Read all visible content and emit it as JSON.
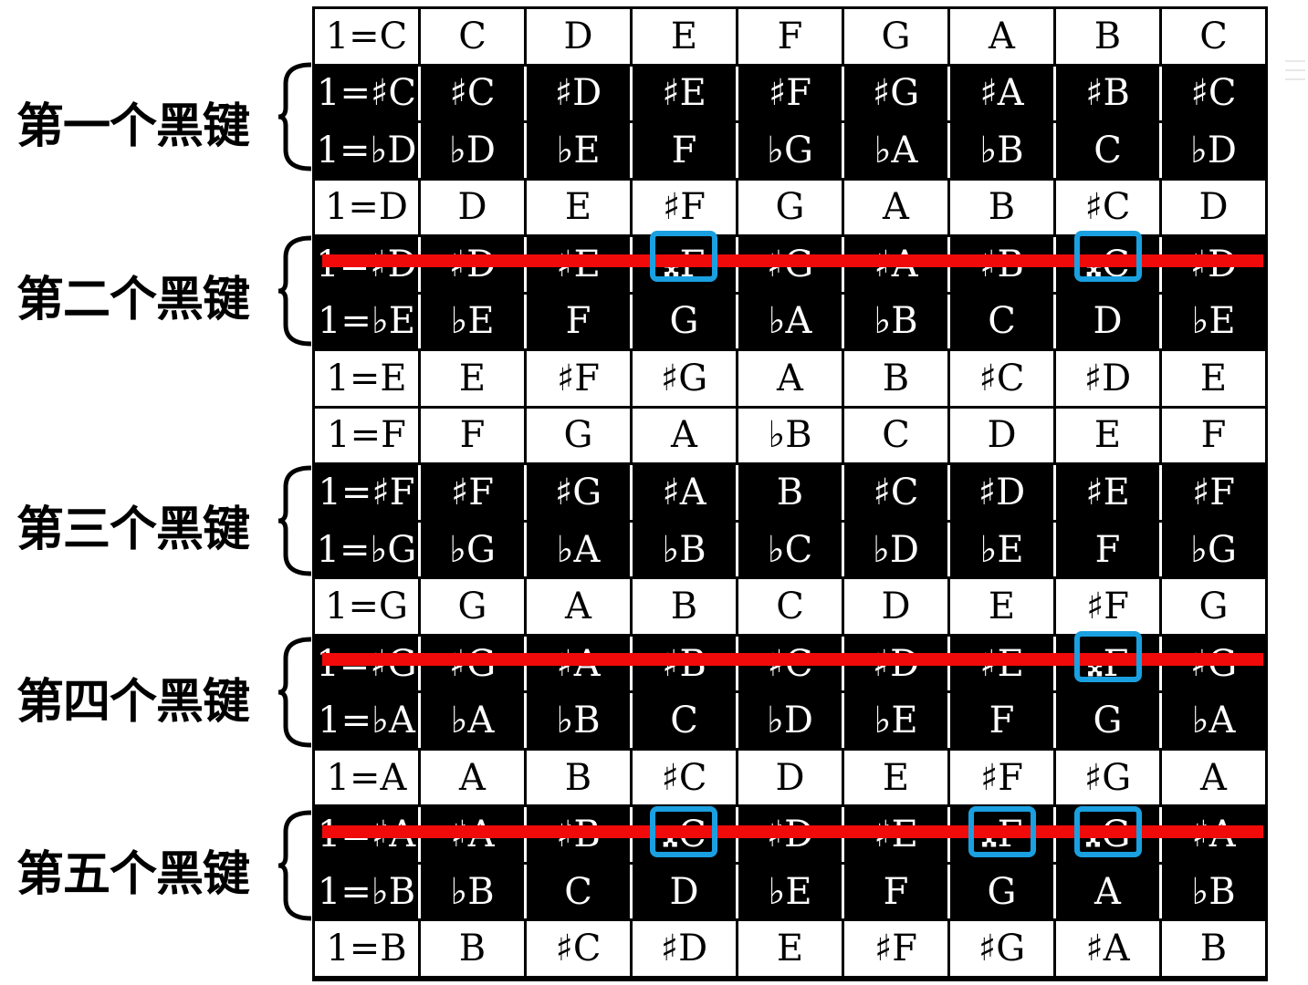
{
  "side_labels": [
    "第一个黑键",
    "第二个黑键",
    "第三个黑键",
    "第四个黑键",
    "第五个黑键"
  ],
  "rows": [
    {
      "shade": "light",
      "cells": [
        "1=C",
        "C",
        "D",
        "E",
        "F",
        "G",
        "A",
        "B",
        "C"
      ]
    },
    {
      "shade": "dark",
      "cells": [
        "1=♯C",
        "♯C",
        "♯D",
        "♯E",
        "♯F",
        "♯G",
        "♯A",
        "♯B",
        "♯C"
      ]
    },
    {
      "shade": "dark",
      "cells": [
        "1=♭D",
        "♭D",
        "♭E",
        "F",
        "♭G",
        "♭A",
        "♭B",
        "C",
        "♭D"
      ]
    },
    {
      "shade": "light",
      "cells": [
        "1=D",
        "D",
        "E",
        "♯F",
        "G",
        "A",
        "B",
        "♯C",
        "D"
      ]
    },
    {
      "shade": "dark",
      "cells": [
        "1=♯D",
        "♯D",
        "♯E",
        "𝄪F",
        "♯G",
        "♯A",
        "♯B",
        "𝄪C",
        "♯D"
      ]
    },
    {
      "shade": "dark",
      "cells": [
        "1=♭E",
        "♭E",
        "F",
        "G",
        "♭A",
        "♭B",
        "C",
        "D",
        "♭E"
      ]
    },
    {
      "shade": "light",
      "cells": [
        "1=E",
        "E",
        "♯F",
        "♯G",
        "A",
        "B",
        "♯C",
        "♯D",
        "E"
      ]
    },
    {
      "shade": "light",
      "cells": [
        "1=F",
        "F",
        "G",
        "A",
        "♭B",
        "C",
        "D",
        "E",
        "F"
      ]
    },
    {
      "shade": "dark",
      "cells": [
        "1=♯F",
        "♯F",
        "♯G",
        "♯A",
        "B",
        "♯C",
        "♯D",
        "♯E",
        "♯F"
      ]
    },
    {
      "shade": "dark",
      "cells": [
        "1=♭G",
        "♭G",
        "♭A",
        "♭B",
        "♭C",
        "♭D",
        "♭E",
        "F",
        "♭G"
      ]
    },
    {
      "shade": "light",
      "cells": [
        "1=G",
        "G",
        "A",
        "B",
        "C",
        "D",
        "E",
        "♯F",
        "G"
      ]
    },
    {
      "shade": "dark",
      "cells": [
        "1=♯G",
        "♯G",
        "♯A",
        "♯B",
        "♯C",
        "♯D",
        "♯E",
        "𝄪F",
        "♯G"
      ]
    },
    {
      "shade": "dark",
      "cells": [
        "1=♭A",
        "♭A",
        "♭B",
        "C",
        "♭D",
        "♭E",
        "F",
        "G",
        "♭A"
      ]
    },
    {
      "shade": "light",
      "cells": [
        "1=A",
        "A",
        "B",
        "♯C",
        "D",
        "E",
        "♯F",
        "♯G",
        "A"
      ]
    },
    {
      "shade": "dark",
      "cells": [
        "1=♯A",
        "♯A",
        "♯B",
        "𝄪C",
        "♯D",
        "♯E",
        "𝄪F",
        "𝄪G",
        "♯A"
      ]
    },
    {
      "shade": "dark",
      "cells": [
        "1=♭B",
        "♭B",
        "C",
        "D",
        "♭E",
        "F",
        "G",
        "A",
        "♭B"
      ]
    },
    {
      "shade": "light",
      "cells": [
        "1=B",
        "B",
        "♯C",
        "♯D",
        "E",
        "♯F",
        "♯G",
        "♯A",
        "B"
      ]
    }
  ],
  "colors": {
    "strike": "#f00a0a",
    "highlight": "#1aa0e0",
    "dark_row": "#000000",
    "light_row": "#ffffff"
  }
}
